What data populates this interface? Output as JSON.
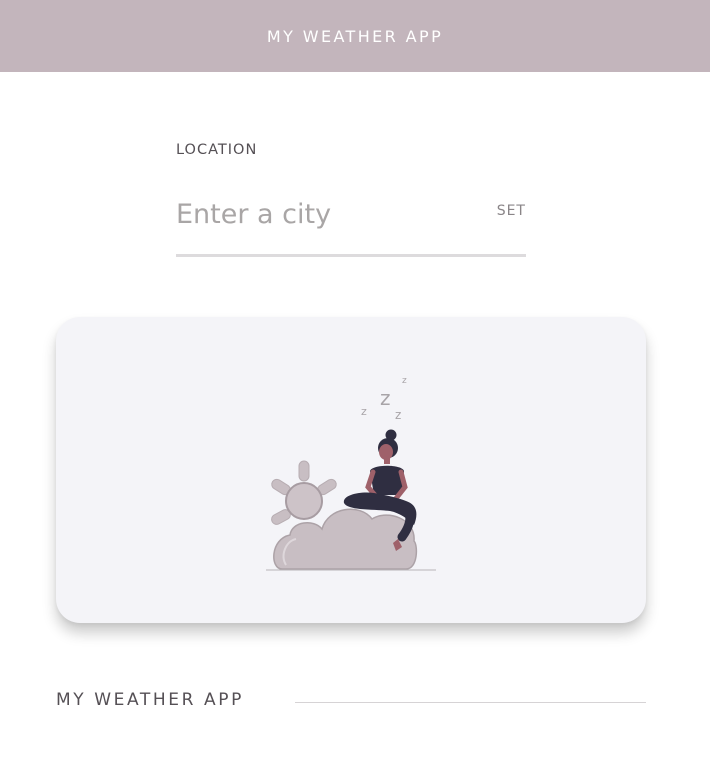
{
  "header": {
    "title": "MY WEATHER APP"
  },
  "location": {
    "label": "LOCATION",
    "placeholder": "Enter a city",
    "value": "",
    "set_label": "SET"
  },
  "card": {
    "illustration": "sleeping-woman-on-cloud-with-sun",
    "zzz": {
      "large": "z",
      "medium": "z",
      "small": "z",
      "tiny": "z"
    }
  },
  "footer": {
    "brand": "MY WEATHER APP"
  },
  "colors": {
    "header_bg": "#c3b5bc",
    "card_bg": "#f4f4f8",
    "accent": "#c3b5bc",
    "text": "#555055"
  }
}
